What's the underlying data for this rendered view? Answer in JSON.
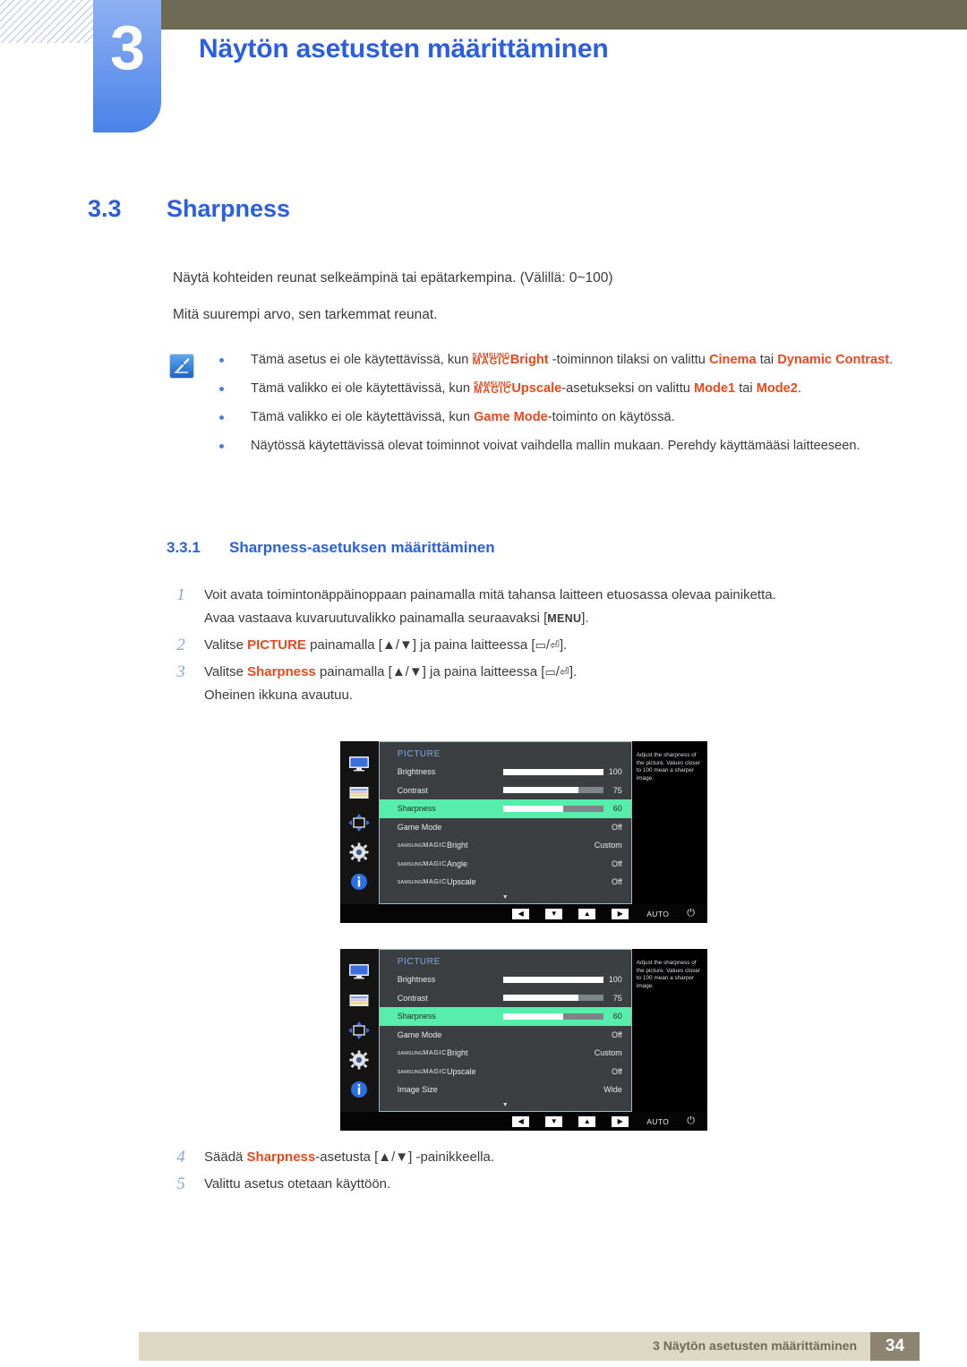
{
  "header": {
    "chapter_number": "3",
    "chapter_title": "Näytön asetusten määrittäminen",
    "bar_color": "#6e6a53",
    "tab_color": "#4a82e8"
  },
  "section": {
    "number": "3.3",
    "title": "Sharpness",
    "paragraph1": "Näytä kohteiden reunat selkeämpinä tai epätarkempina. (Välillä: 0~100)",
    "paragraph2": "Mitä suurempi arvo, sen tarkemmat reunat."
  },
  "note": {
    "icon": "note-pen-icon",
    "bullets": [
      {
        "pre": "Tämä asetus ei ole käytettävissä, kun ",
        "magic_top": "SAMSUNG",
        "magic_bottom": "MAGIC",
        "magic_suffix": "Bright",
        "mid": " -toiminnon tilaksi on valittu ",
        "hl1": "Cinema",
        "mid2": " tai ",
        "hl2": "Dynamic Contrast",
        "post": "."
      },
      {
        "pre": "Tämä valikko ei ole käytettävissä, kun ",
        "magic_top": "SAMSUNG",
        "magic_bottom": "MAGIC",
        "magic_suffix": "Upscale",
        "mid": "-asetukseksi on valittu ",
        "hl1": "Mode1",
        "mid2": " tai ",
        "hl2": "Mode2",
        "post": "."
      },
      {
        "pre": "Tämä valikko ei ole käytettävissä, kun ",
        "hl1": "Game Mode",
        "mid": "-toiminto on käytössä.",
        "post": ""
      },
      {
        "pre": "Näytössä käytettävissä olevat toiminnot voivat vaihdella mallin mukaan. Perehdy käyttämääsi laitteeseen.",
        "post": ""
      }
    ]
  },
  "subsection": {
    "number": "3.3.1",
    "title": "Sharpness-asetuksen määrittäminen"
  },
  "steps": [
    {
      "number": "1",
      "line1": "Voit avata toimintonäppäinoppaan painamalla mitä tahansa laitteen etuosassa olevaa painiketta.",
      "line2_pre": "Avaa vastaava kuvaruutuvalikko painamalla seuraavaksi [",
      "line2_key": "MENU",
      "line2_post": "]."
    },
    {
      "number": "2",
      "pre": "Valitse ",
      "hl": "PICTURE",
      "mid": " painamalla [▲/▼] ja paina laitteessa [",
      "key1": "▭",
      "key2": "⏎",
      "post": "]."
    },
    {
      "number": "3",
      "pre": "Valitse ",
      "hl": "Sharpness",
      "mid": " painamalla [▲/▼] ja paina laitteessa [",
      "key1": "▭",
      "key2": "⏎",
      "post": "].",
      "note": "Oheinen ikkuna avautuu."
    }
  ],
  "steps_after": [
    {
      "number": "4",
      "pre": "Säädä ",
      "hl": "Sharpness",
      "post": "-asetusta [▲/▼] -painikkeella."
    },
    {
      "number": "5",
      "pre": "Valittu asetus otetaan käyttöön.",
      "hl": "",
      "post": ""
    }
  ],
  "osd": {
    "title": "PICTURE",
    "help_text": "Adjust the sharpness of the picture. Values closer to 100 mean a sharper image.",
    "rail_icons": [
      "monitor-icon",
      "color-bars-icon",
      "resize-arrows-icon",
      "gear-icon",
      "info-icon"
    ],
    "footer": {
      "keys": [
        "◀",
        "▼",
        "▲",
        "▶"
      ],
      "auto_label": "AUTO",
      "power_icon": "⏻"
    },
    "screen1": {
      "rows": [
        {
          "label": "Brightness",
          "value": "100",
          "bar": 100,
          "selected": false,
          "magic": false
        },
        {
          "label": "Contrast",
          "value": "75",
          "bar": 75,
          "selected": false,
          "magic": false
        },
        {
          "label": "Sharpness",
          "value": "60",
          "bar": 60,
          "selected": true,
          "magic": false
        },
        {
          "label": "Game Mode",
          "value": "Off",
          "bar": null,
          "selected": false,
          "magic": false
        },
        {
          "label": "Bright",
          "value": "Custom",
          "bar": null,
          "selected": false,
          "magic": true
        },
        {
          "label": "Angle",
          "value": "Off",
          "bar": null,
          "selected": false,
          "magic": true
        },
        {
          "label": "Upscale",
          "value": "Off",
          "bar": null,
          "selected": false,
          "magic": true
        }
      ]
    },
    "screen2": {
      "rows": [
        {
          "label": "Brightness",
          "value": "100",
          "bar": 100,
          "selected": false,
          "magic": false
        },
        {
          "label": "Contrast",
          "value": "75",
          "bar": 75,
          "selected": false,
          "magic": false
        },
        {
          "label": "Sharpness",
          "value": "60",
          "bar": 60,
          "selected": true,
          "magic": false
        },
        {
          "label": "Game Mode",
          "value": "Off",
          "bar": null,
          "selected": false,
          "magic": false
        },
        {
          "label": "Bright",
          "value": "Custom",
          "bar": null,
          "selected": false,
          "magic": true
        },
        {
          "label": "Upscale",
          "value": "Off",
          "bar": null,
          "selected": false,
          "magic": true
        },
        {
          "label": "Image Size",
          "value": "Wide",
          "bar": null,
          "selected": false,
          "magic": false
        }
      ]
    },
    "magic_top": "SAMSUNG",
    "magic_bottom": "MAGIC",
    "scroll_caret": "▼",
    "highlight_color": "#57eeab"
  },
  "footer": {
    "label": "3 Näytön asetusten määrittäminen",
    "page": "34"
  }
}
